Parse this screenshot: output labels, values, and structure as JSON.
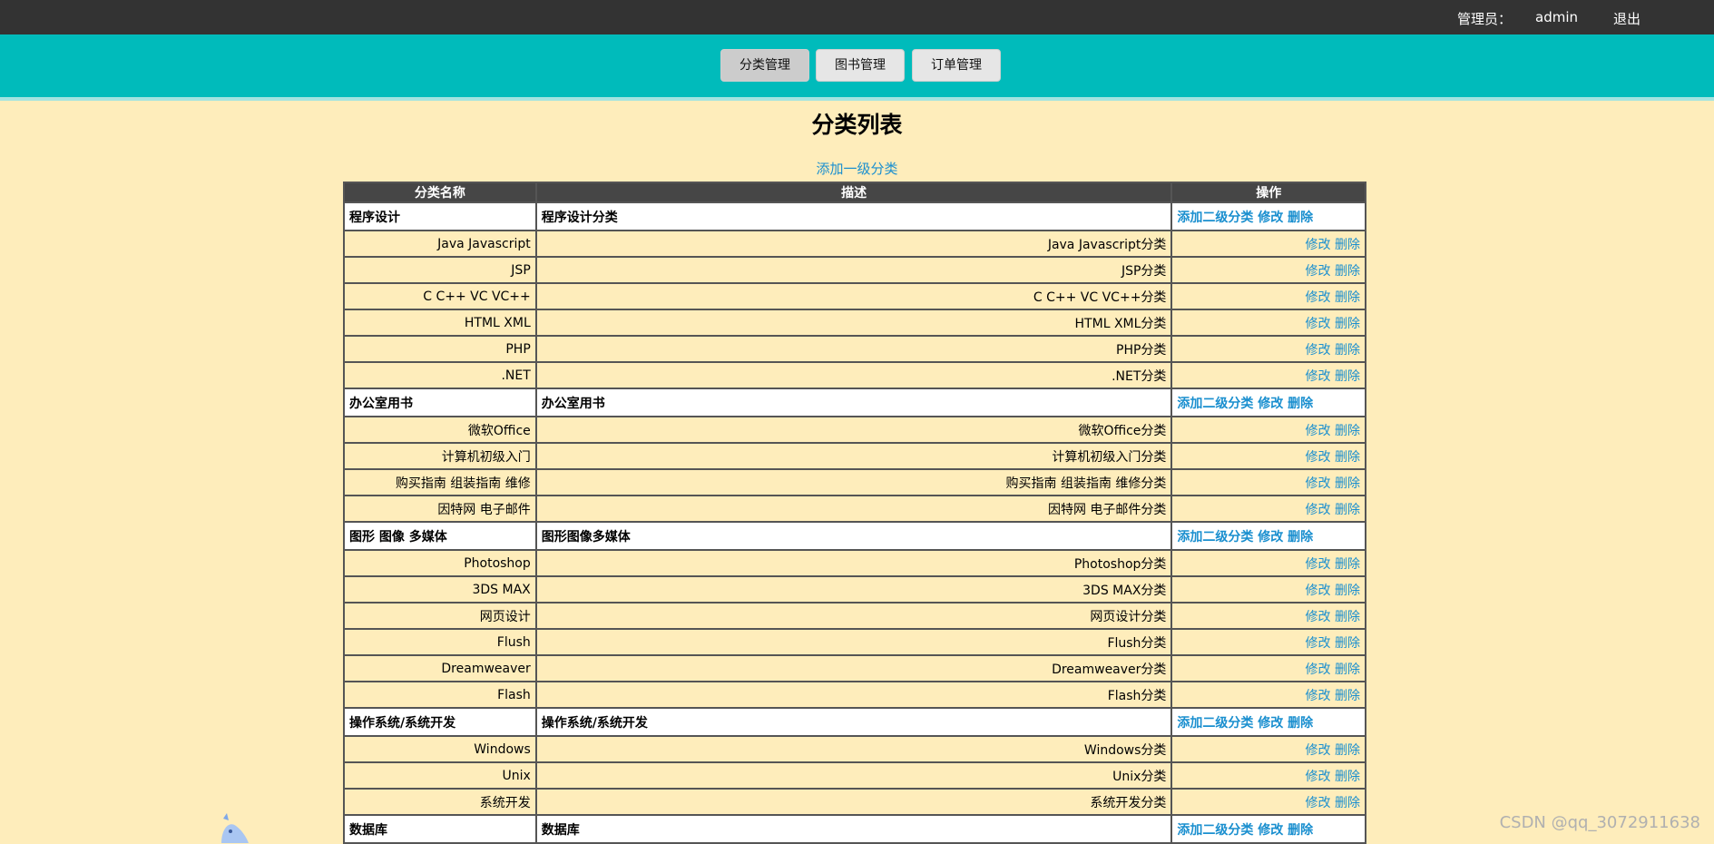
{
  "topbar": {
    "admin_label": "管理员：",
    "username": "admin",
    "logout": "退出"
  },
  "nav": {
    "tabs": [
      {
        "label": "分类管理",
        "active": true
      },
      {
        "label": "图书管理",
        "active": false
      },
      {
        "label": "订单管理",
        "active": false
      }
    ]
  },
  "page": {
    "title": "分类列表",
    "add_primary_link": "添加一级分类"
  },
  "table": {
    "headers": [
      "分类名称",
      "描述",
      "操作"
    ],
    "add_child_label": "添加二级分类",
    "edit_label": "修改",
    "delete_label": "删除",
    "groups": [
      {
        "name": "程序设计",
        "desc": "程序设计分类",
        "children": [
          {
            "name": "Java Javascript",
            "desc": "Java Javascript分类"
          },
          {
            "name": "JSP",
            "desc": "JSP分类"
          },
          {
            "name": "C C++ VC VC++",
            "desc": "C C++ VC VC++分类"
          },
          {
            "name": "HTML XML",
            "desc": "HTML XML分类"
          },
          {
            "name": "PHP",
            "desc": "PHP分类"
          },
          {
            "name": ".NET",
            "desc": ".NET分类"
          }
        ]
      },
      {
        "name": "办公室用书",
        "desc": "办公室用书",
        "children": [
          {
            "name": "微软Office",
            "desc": "微软Office分类"
          },
          {
            "name": "计算机初级入门",
            "desc": "计算机初级入门分类"
          },
          {
            "name": "购买指南 组装指南 维修",
            "desc": "购买指南 组装指南 维修分类"
          },
          {
            "name": "因特网 电子邮件",
            "desc": "因特网 电子邮件分类"
          }
        ]
      },
      {
        "name": "图形 图像 多媒体",
        "desc": "图形图像多媒体",
        "children": [
          {
            "name": "Photoshop",
            "desc": "Photoshop分类"
          },
          {
            "name": "3DS MAX",
            "desc": "3DS MAX分类"
          },
          {
            "name": "网页设计",
            "desc": "网页设计分类"
          },
          {
            "name": "Flush",
            "desc": "Flush分类"
          },
          {
            "name": "Dreamweaver",
            "desc": "Dreamweaver分类"
          },
          {
            "name": "Flash",
            "desc": "Flash分类"
          }
        ]
      },
      {
        "name": "操作系统/系统开发",
        "desc": "操作系统/系统开发",
        "children": [
          {
            "name": "Windows",
            "desc": "Windows分类"
          },
          {
            "name": "Unix",
            "desc": "Unix分类"
          },
          {
            "name": "系统开发",
            "desc": "系统开发分类"
          }
        ]
      },
      {
        "name": "数据库",
        "desc": "数据库",
        "children": []
      }
    ]
  },
  "watermark": "CSDN @qq_3072911638"
}
